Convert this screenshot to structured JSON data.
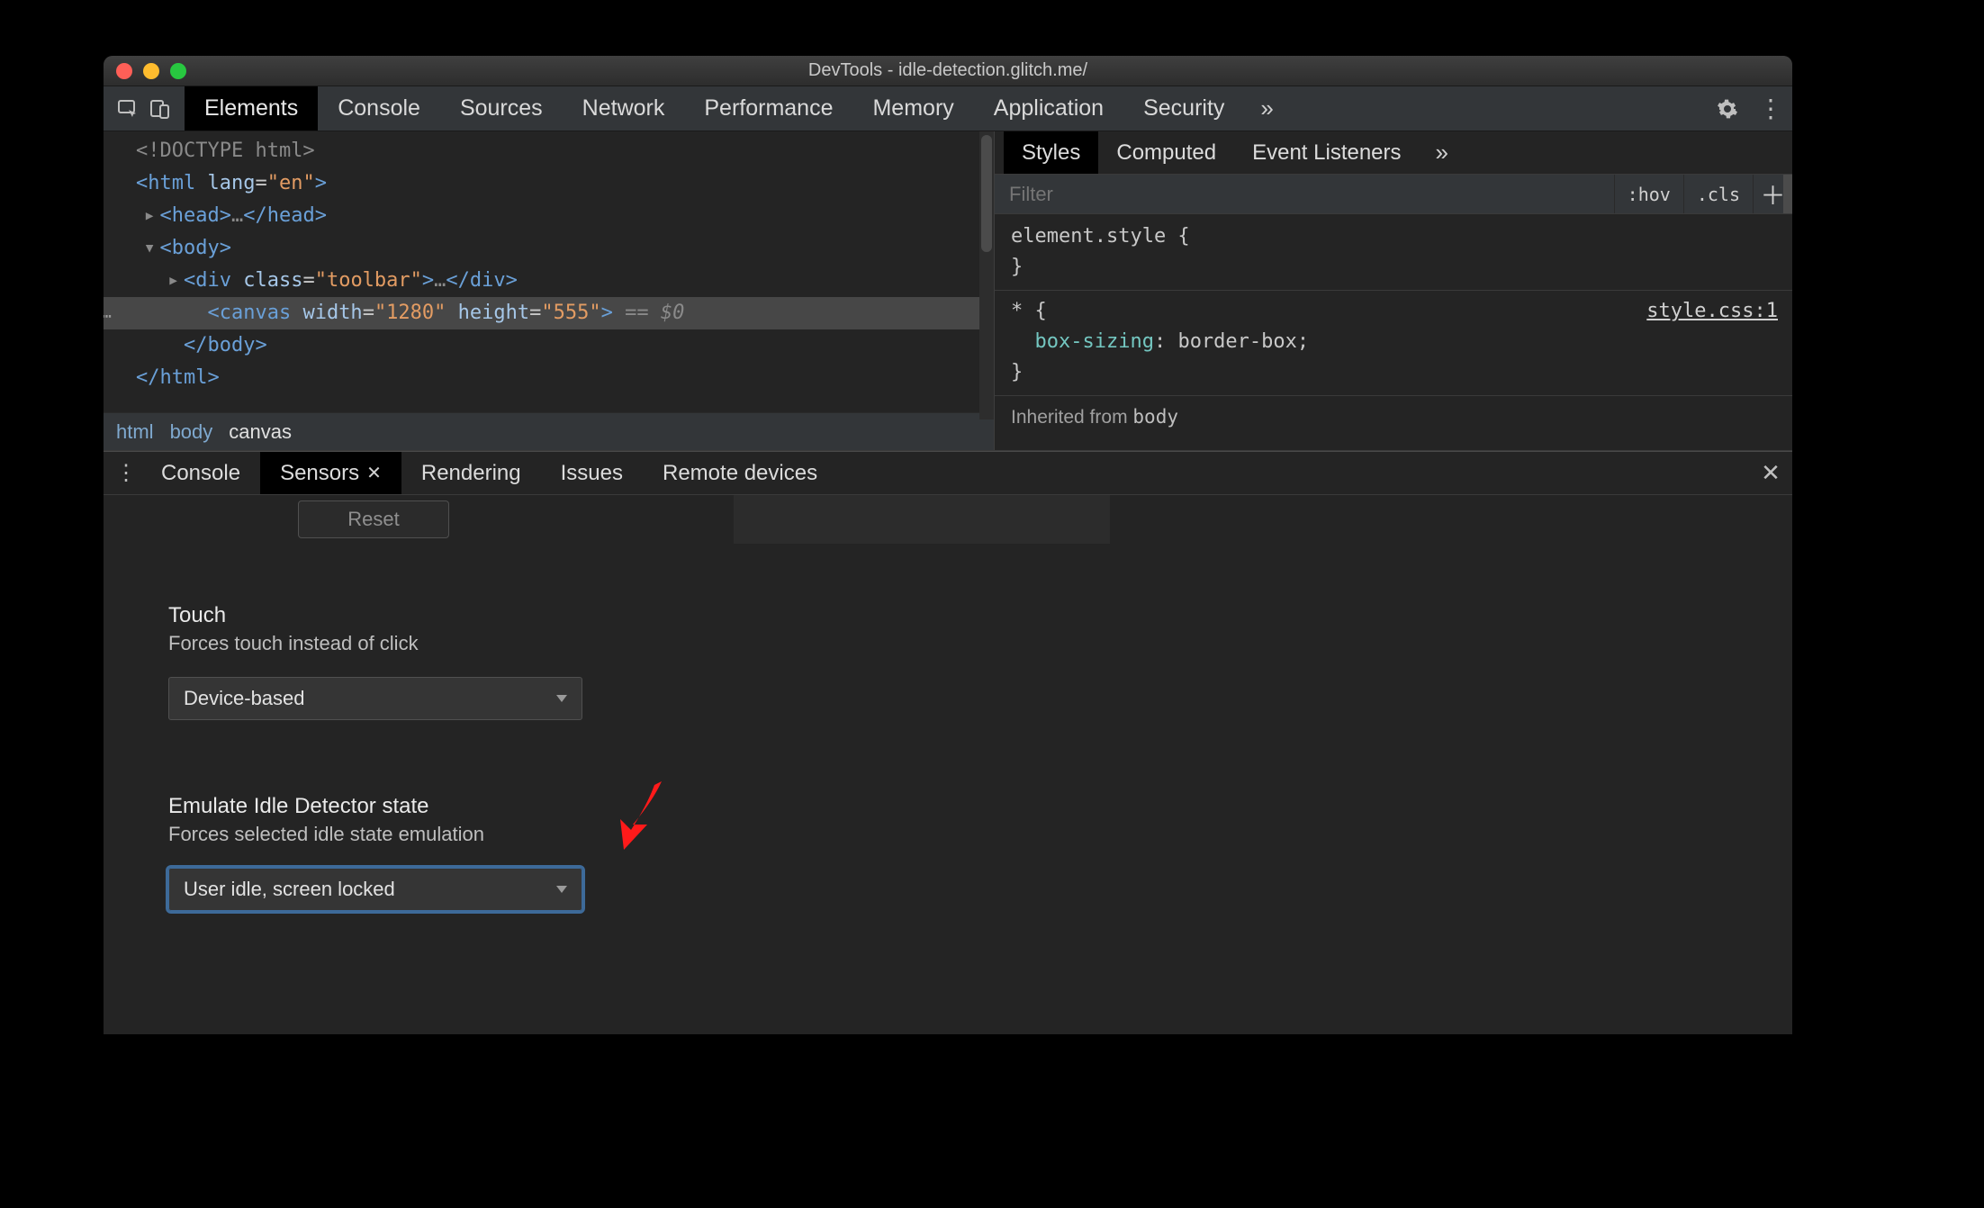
{
  "window": {
    "title": "DevTools - idle-detection.glitch.me/"
  },
  "toolbar": {
    "tabs": [
      "Elements",
      "Console",
      "Sources",
      "Network",
      "Performance",
      "Memory",
      "Application",
      "Security"
    ],
    "more_glyph": "»",
    "active_index": 0
  },
  "dom": {
    "lines": [
      {
        "indent": 0,
        "pre": "",
        "html": "<span class='dom-gray'>&lt;!DOCTYPE html&gt;</span>"
      },
      {
        "indent": 0,
        "pre": "",
        "html": "<span class='dom-tag'>&lt;html</span> <span class='dom-attr'>lang</span><span class='dom-white'>=</span><span class='dom-val'>\"en\"</span><span class='dom-tag'>&gt;</span>"
      },
      {
        "indent": 1,
        "pre": "▸",
        "html": "<span class='dom-tag'>&lt;head&gt;</span><span class='dom-gray'>…</span><span class='dom-tag'>&lt;/head&gt;</span>"
      },
      {
        "indent": 1,
        "pre": "▾",
        "html": "<span class='dom-tag'>&lt;body&gt;</span>"
      },
      {
        "indent": 2,
        "pre": "▸",
        "html": "<span class='dom-tag'>&lt;div</span> <span class='dom-attr'>class</span><span class='dom-white'>=</span><span class='dom-val'>\"toolbar\"</span><span class='dom-tag'>&gt;</span><span class='dom-gray'>…</span><span class='dom-tag'>&lt;/div&gt;</span>"
      },
      {
        "indent": 2,
        "pre": "",
        "selected": true,
        "html": "  <span class='dom-tag'>&lt;canvas</span> <span class='dom-attr'>width</span><span class='dom-white'>=</span><span class='dom-val'>\"1280\"</span> <span class='dom-attr'>height</span><span class='dom-white'>=</span><span class='dom-val'>\"555\"</span><span class='dom-tag'>&gt;</span><span class='dom-gray'> == </span><span class='dom-eq' style='font-style:italic'>$0</span>"
      },
      {
        "indent": 1,
        "pre": "",
        "html": "  <span class='dom-tag'>&lt;/body&gt;</span>"
      },
      {
        "indent": 0,
        "pre": "",
        "html": "<span class='dom-tag'>&lt;/html&gt;</span>"
      }
    ]
  },
  "breadcrumb": {
    "items": [
      "html",
      "body",
      "canvas"
    ],
    "current_index": 2
  },
  "styles": {
    "tabs": [
      "Styles",
      "Computed",
      "Event Listeners"
    ],
    "active_index": 0,
    "more_glyph": "»",
    "filter_placeholder": "Filter",
    "hov": ":hov",
    "cls": ".cls",
    "rules": {
      "element_style_open": "element.style {",
      "brace_close": "}",
      "star_open": "* {",
      "star_link": "style.css:1",
      "star_decl_prop": "box-sizing",
      "star_decl_val": ": border-box;",
      "inherit_label": "Inherited from",
      "inherit_from": "body"
    }
  },
  "drawer": {
    "tabs": [
      {
        "label": "Console",
        "closable": false
      },
      {
        "label": "Sensors",
        "closable": true
      },
      {
        "label": "Rendering",
        "closable": false
      },
      {
        "label": "Issues",
        "closable": false
      },
      {
        "label": "Remote devices",
        "closable": false
      }
    ],
    "active_index": 1,
    "reset_label": "Reset",
    "touch": {
      "title": "Touch",
      "sub": "Forces touch instead of click",
      "value": "Device-based"
    },
    "idle": {
      "title": "Emulate Idle Detector state",
      "sub": "Forces selected idle state emulation",
      "value": "User idle, screen locked"
    }
  },
  "annotation": {
    "arrow_color": "#ff0000"
  }
}
